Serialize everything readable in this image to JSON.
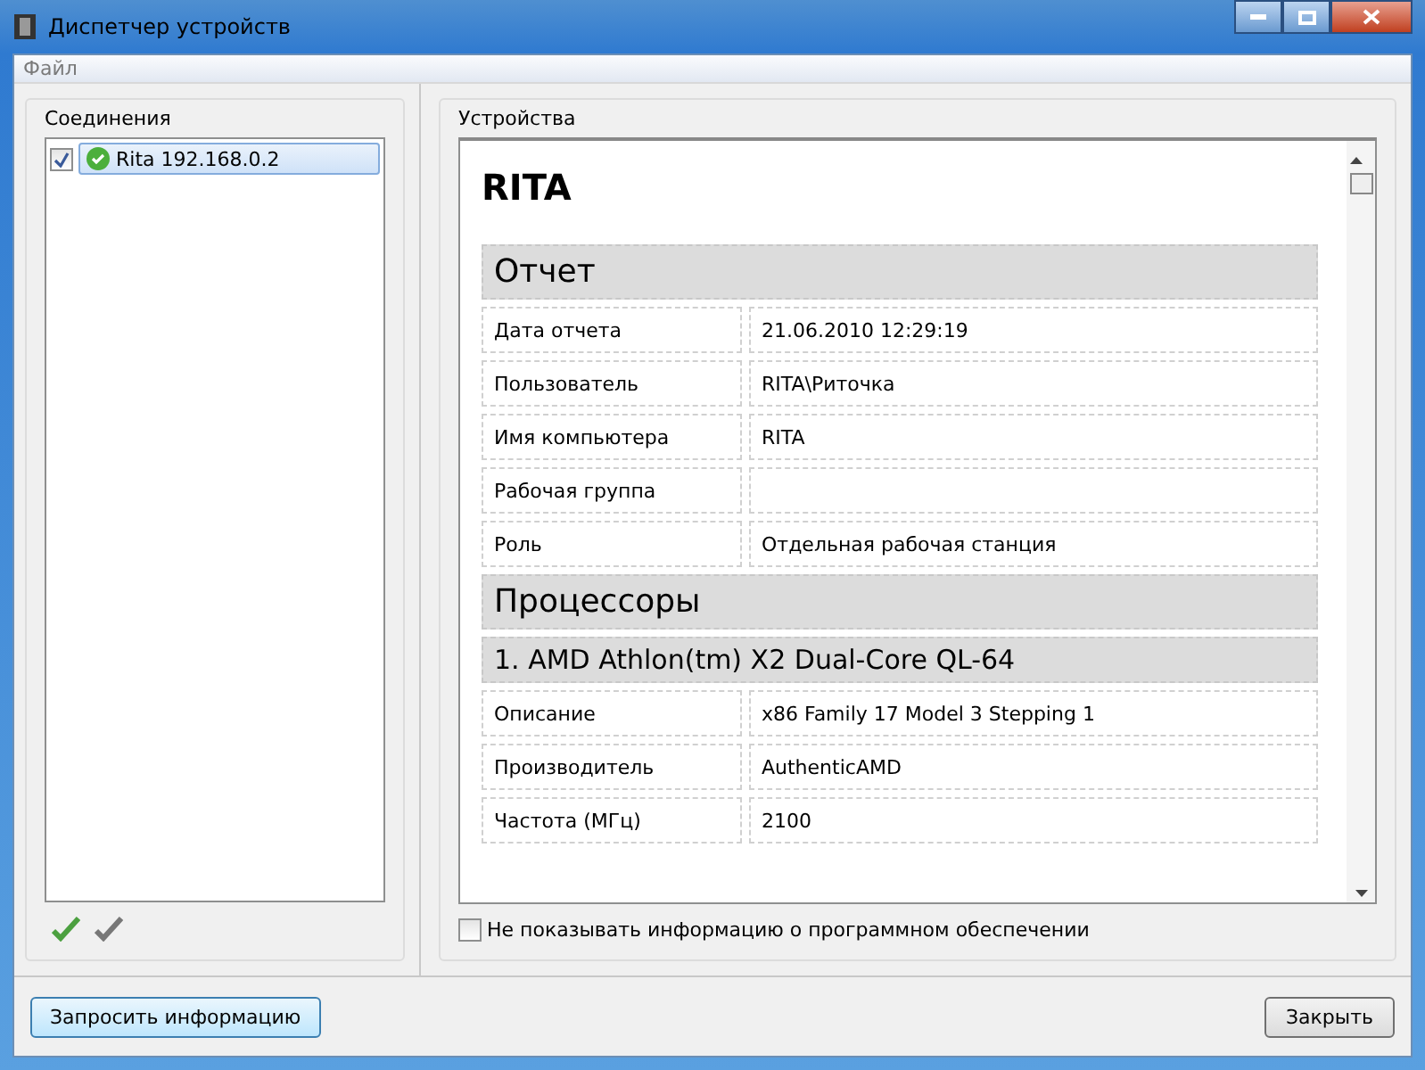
{
  "window": {
    "title": "Диспетчер устройств"
  },
  "menu": [
    "Файл"
  ],
  "connections": {
    "title": "Соединения",
    "items": [
      {
        "label": "Rita 192.168.0.2",
        "checked": true,
        "selected": true
      }
    ]
  },
  "devices": {
    "title": "Устройства",
    "heading": "RITA",
    "sections": [
      {
        "kind": "section",
        "title": "Отчет"
      },
      {
        "kind": "row",
        "label": "Дата отчета",
        "value": "21.06.2010 12:29:19"
      },
      {
        "kind": "row",
        "label": "Пользователь",
        "value": "RITA\\Риточка"
      },
      {
        "kind": "row",
        "label": "Имя компьютера",
        "value": "RITA"
      },
      {
        "kind": "row",
        "label": "Рабочая группа"
      },
      {
        "kind": "row",
        "label": "Роль",
        "value": "Отдельная рабочая станция"
      },
      {
        "kind": "section",
        "title": "Процессоры"
      },
      {
        "kind": "subsection",
        "title": "1. AMD Athlon(tm) X2 Dual-Core QL-64"
      },
      {
        "kind": "row",
        "label": "Описание",
        "value": "x86 Family 17 Model 3 Stepping 1"
      },
      {
        "kind": "row",
        "label": "Производитель",
        "value": "AuthenticAMD"
      },
      {
        "kind": "row",
        "label": "Частота (МГц)",
        "value": "2100"
      }
    ],
    "hide_software": {
      "label": "Не показывать информацию о программном обеспечении",
      "checked": false
    }
  },
  "buttons": {
    "request": "Запросить информацию",
    "close": "Закрыть"
  }
}
